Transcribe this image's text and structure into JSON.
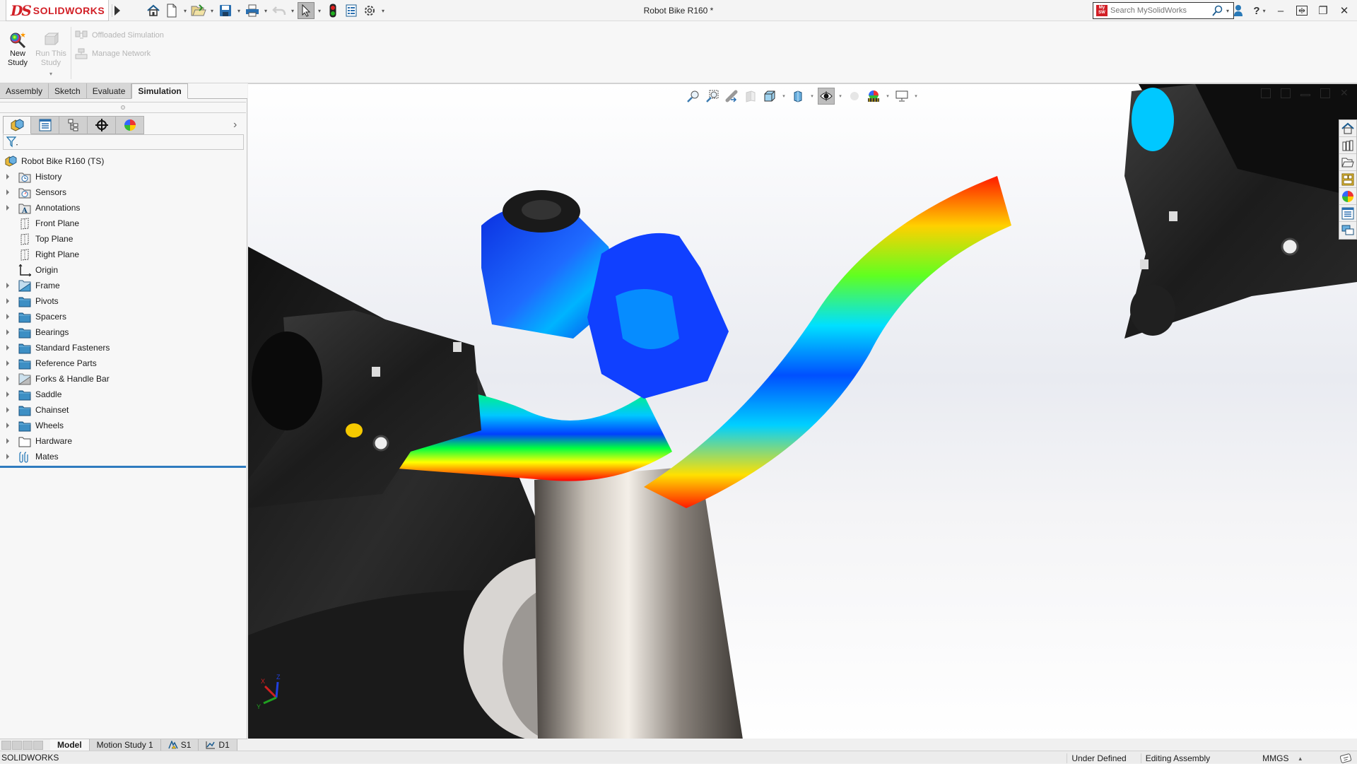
{
  "app": {
    "brand": "SOLIDWORKS",
    "brand_prefix": "DS",
    "brand_color": "#d21f26",
    "document_title": "Robot Bike R160 *"
  },
  "quick_access": {
    "icons": [
      "home-icon",
      "new-document-icon",
      "open-icon",
      "save-icon",
      "print-icon",
      "undo-icon",
      "select-icon",
      "rebuild-icon",
      "file-properties-icon",
      "options-icon"
    ]
  },
  "search": {
    "placeholder": "Search MySolidWorks",
    "badge": "My SW"
  },
  "window_controls": {
    "user": "user-icon",
    "help": "?",
    "minimize": "–",
    "restore": "❐",
    "close": "✕"
  },
  "command_manager": {
    "new_study": "New Study",
    "new_study_line1": "New",
    "new_study_line2": "Study",
    "run_study_line1": "Run This",
    "run_study_line2": "Study",
    "offloaded_simulation": "Offloaded Simulation",
    "manage_network": "Manage Network",
    "tabs": [
      {
        "label": "Assembly",
        "active": false
      },
      {
        "label": "Sketch",
        "active": false
      },
      {
        "label": "Evaluate",
        "active": false
      },
      {
        "label": "Simulation",
        "active": true
      }
    ]
  },
  "feature_manager": {
    "panel_tabs": [
      "featuremanager-tree",
      "propertymanager",
      "configurationmanager",
      "dimxpertmanager",
      "displaymanager"
    ],
    "root": "Robot Bike R160  (TS)",
    "items": [
      {
        "label": "History",
        "icon": "history-folder",
        "expandable": true
      },
      {
        "label": "Sensors",
        "icon": "sensors-folder",
        "expandable": true
      },
      {
        "label": "Annotations",
        "icon": "annotations-folder",
        "expandable": true
      },
      {
        "label": "Front Plane",
        "icon": "plane",
        "expandable": false
      },
      {
        "label": "Top Plane",
        "icon": "plane",
        "expandable": false
      },
      {
        "label": "Right Plane",
        "icon": "plane",
        "expandable": false
      },
      {
        "label": "Origin",
        "icon": "origin",
        "expandable": false
      },
      {
        "label": "Frame",
        "icon": "subassembly-folder",
        "expandable": true
      },
      {
        "label": "Pivots",
        "icon": "folder",
        "expandable": true
      },
      {
        "label": "Spacers",
        "icon": "folder",
        "expandable": true
      },
      {
        "label": "Bearings",
        "icon": "folder",
        "expandable": true
      },
      {
        "label": "Standard Fasteners",
        "icon": "folder",
        "expandable": true
      },
      {
        "label": "Reference Parts",
        "icon": "folder",
        "expandable": true
      },
      {
        "label": "Forks  & Handle Bar",
        "icon": "subassembly-folder-light",
        "expandable": true
      },
      {
        "label": "Saddle",
        "icon": "folder",
        "expandable": true
      },
      {
        "label": "Chainset",
        "icon": "folder",
        "expandable": true
      },
      {
        "label": "Wheels",
        "icon": "folder",
        "expandable": true
      },
      {
        "label": "Hardware",
        "icon": "empty-folder",
        "expandable": true
      },
      {
        "label": "Mates",
        "icon": "mates",
        "expandable": true
      }
    ]
  },
  "viewport": {
    "heads_up_toolbar": [
      "zoom-to-fit-icon",
      "zoom-to-area-icon",
      "previous-view-icon",
      "section-view-icon",
      "view-orientation-icon",
      "display-style-icon",
      "hide-show-items-icon",
      "edit-appearance-icon",
      "apply-scene-icon",
      "view-settings-icon"
    ],
    "task_pane": [
      "solidworks-resources-icon",
      "design-library-icon",
      "file-explorer-icon",
      "view-palette-icon",
      "appearances-scenes-icon",
      "custom-properties-icon",
      "forum-icon"
    ],
    "triad": {
      "x": "X",
      "y": "Y",
      "z": "Z"
    },
    "stress_colors": [
      "#0026ff",
      "#00c8ff",
      "#00ff40",
      "#ffff00",
      "#ff0000"
    ]
  },
  "bottom_tabs": [
    {
      "label": "Model",
      "active": true
    },
    {
      "label": "Motion Study 1",
      "active": false
    },
    {
      "label": "S1",
      "active": false,
      "icon": "simulation-study-icon"
    },
    {
      "label": "D1",
      "active": false,
      "icon": "design-study-icon"
    }
  ],
  "status_bar": {
    "app": "SOLIDWORKS",
    "definition": "Under Defined",
    "mode": "Editing Assembly",
    "units": "MMGS",
    "units_arrow": "▴"
  }
}
